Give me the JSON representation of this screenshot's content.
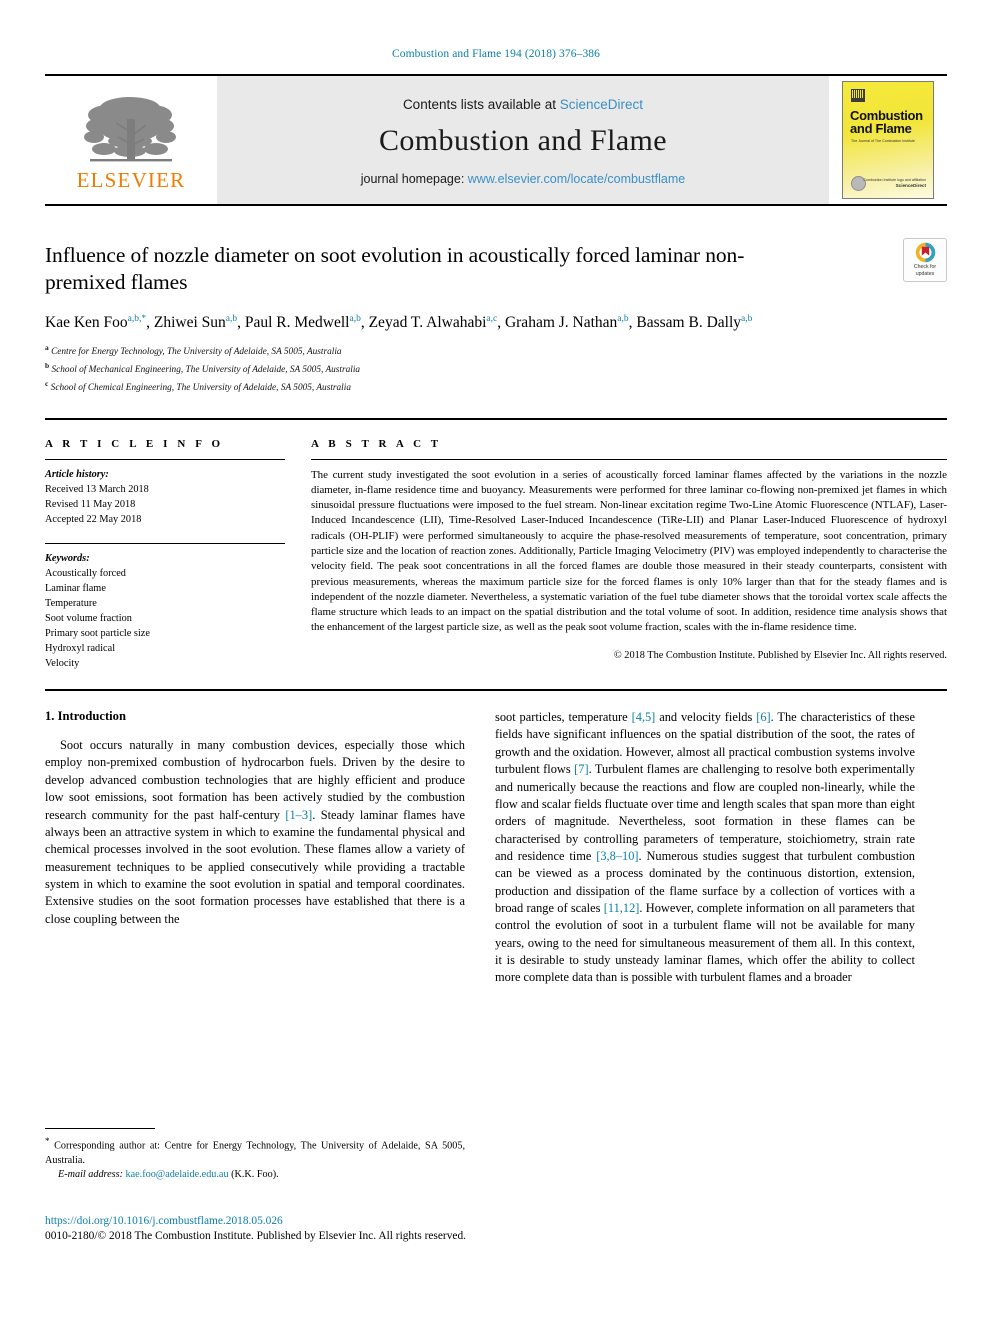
{
  "running_head": "Combustion and Flame 194 (2018) 376–386",
  "masthead": {
    "publisher_name": "ELSEVIER",
    "contents_prefix": "Contents lists available at ",
    "contents_link": "ScienceDirect",
    "journal_title": "Combustion and Flame",
    "homepage_prefix": "journal homepage: ",
    "homepage_url": "www.elsevier.com/locate/combustflame",
    "cover": {
      "title_line1": "Combustion",
      "title_line2": "and Flame",
      "subtitle": "The Journal of The Combustion Institute",
      "footer_line1": "Combustion Institute logo and affiliation",
      "footer_line2": "ScienceDirect"
    }
  },
  "crossmark": {
    "line1": "Check for",
    "line2": "updates"
  },
  "article": {
    "title": "Influence of nozzle diameter on soot evolution in acoustically forced laminar non-premixed flames",
    "authors_html": "Kae Ken Foo<sup>a,b,*</sup>, Zhiwei Sun<sup>a,b</sup>, Paul R. Medwell<sup>a,b</sup>, Zeyad T. Alwahabi<sup>a,c</sup>, Graham J. Nathan<sup>a,b</sup>, Bassam B. Dally<sup>a,b</sup>",
    "affiliations": [
      {
        "marker": "a",
        "text": "Centre for Energy Technology, The University of Adelaide, SA 5005, Australia"
      },
      {
        "marker": "b",
        "text": "School of Mechanical Engineering, The University of Adelaide, SA 5005, Australia"
      },
      {
        "marker": "c",
        "text": "School of Chemical Engineering, The University of Adelaide, SA 5005, Australia"
      }
    ]
  },
  "article_info": {
    "heading": "A R T I C L E   I N F O",
    "history_label": "Article history:",
    "history": [
      "Received 13 March 2018",
      "Revised 11 May 2018",
      "Accepted 22 May 2018"
    ],
    "keywords_label": "Keywords:",
    "keywords": [
      "Acoustically forced",
      "Laminar flame",
      "Temperature",
      "Soot volume fraction",
      "Primary soot particle size",
      "Hydroxyl radical",
      "Velocity"
    ]
  },
  "abstract": {
    "heading": "A B S T R A C T",
    "text": "The current study investigated the soot evolution in a series of acoustically forced laminar flames affected by the variations in the nozzle diameter, in-flame residence time and buoyancy. Measurements were performed for three laminar co-flowing non-premixed jet flames in which sinusoidal pressure fluctuations were imposed to the fuel stream. Non-linear excitation regime Two-Line Atomic Fluorescence (NTLAF), Laser-Induced Incandescence (LII), Time-Resolved Laser-Induced Incandescence (TiRe-LII) and Planar Laser-Induced Fluorescence of hydroxyl radicals (OH-PLIF) were performed simultaneously to acquire the phase-resolved measurements of temperature, soot concentration, primary particle size and the location of reaction zones. Additionally, Particle Imaging Velocimetry (PIV) was employed independently to characterise the velocity field. The peak soot concentrations in all the forced flames are double those measured in their steady counterparts, consistent with previous measurements, whereas the maximum particle size for the forced flames is only 10% larger than that for the steady flames and is independent of the nozzle diameter. Nevertheless, a systematic variation of the fuel tube diameter shows that the toroidal vortex scale affects the flame structure which leads to an impact on the spatial distribution and the total volume of soot. In addition, residence time analysis shows that the enhancement of the largest particle size, as well as the peak soot volume fraction, scales with the in-flame residence time.",
    "copyright": "© 2018 The Combustion Institute. Published by Elsevier Inc. All rights reserved."
  },
  "introduction": {
    "heading": "1. Introduction",
    "left_para_html": "Soot occurs naturally in many combustion devices, especially those which employ non-premixed combustion of hydrocarbon fuels. Driven by the desire to develop advanced combustion technologies that are highly efficient and produce low soot emissions, soot formation has been actively studied by the combustion research community for the past half-century <span class=\"ref\">[1–3]</span>. Steady laminar flames have always been an attractive system in which to examine the fundamental physical and chemical processes involved in the soot evolution. These flames allow a variety of measurement techniques to be applied consecutively while providing a tractable system in which to examine the soot evolution in spatial and temporal coordinates. Extensive studies on the soot formation processes have established that there is a close coupling between the",
    "right_para_html": "soot particles, temperature <span class=\"ref\">[4,5]</span> and velocity fields <span class=\"ref\">[6]</span>. The characteristics of these fields have significant influences on the spatial distribution of the soot, the rates of growth and the oxidation. However, almost all practical combustion systems involve turbulent flows <span class=\"ref\">[7]</span>. Turbulent flames are challenging to resolve both experimentally and numerically because the reactions and flow are coupled non-linearly, while the flow and scalar fields fluctuate over time and length scales that span more than eight orders of magnitude. Nevertheless, soot formation in these flames can be characterised by controlling parameters of temperature, stoichiometry, strain rate and residence time <span class=\"ref\">[3,8–10]</span>. Numerous studies suggest that turbulent combustion can be viewed as a process dominated by the continuous distortion, extension, production and dissipation of the flame surface by a collection of vortices with a broad range of scales <span class=\"ref\">[11,12]</span>. However, complete information on all parameters that control the evolution of soot in a turbulent flame will not be available for many years, owing to the need for simultaneous measurement of them all. In this context, it is desirable to study unsteady laminar flames, which offer the ability to collect more complete data than is possible with turbulent flames and a broader"
  },
  "footnote": {
    "corresponding_html": "<span class=\"star\">*</span> Corresponding author at: Centre for Energy Technology, The University of Adelaide, SA 5005, Australia.",
    "email_label": "E-mail address:",
    "email": "kae.foo@adelaide.edu.au",
    "email_owner": "(K.K. Foo)."
  },
  "footer": {
    "doi": "https://doi.org/10.1016/j.combustflame.2018.05.026",
    "issn_line": "0010-2180/© 2018 The Combustion Institute. Published by Elsevier Inc. All rights reserved."
  },
  "colors": {
    "link": "#0b7fab",
    "elsevier_orange": "#f07c00",
    "masthead_grey": "#e9e9e9",
    "cover_yellow": "#f5e93b"
  }
}
